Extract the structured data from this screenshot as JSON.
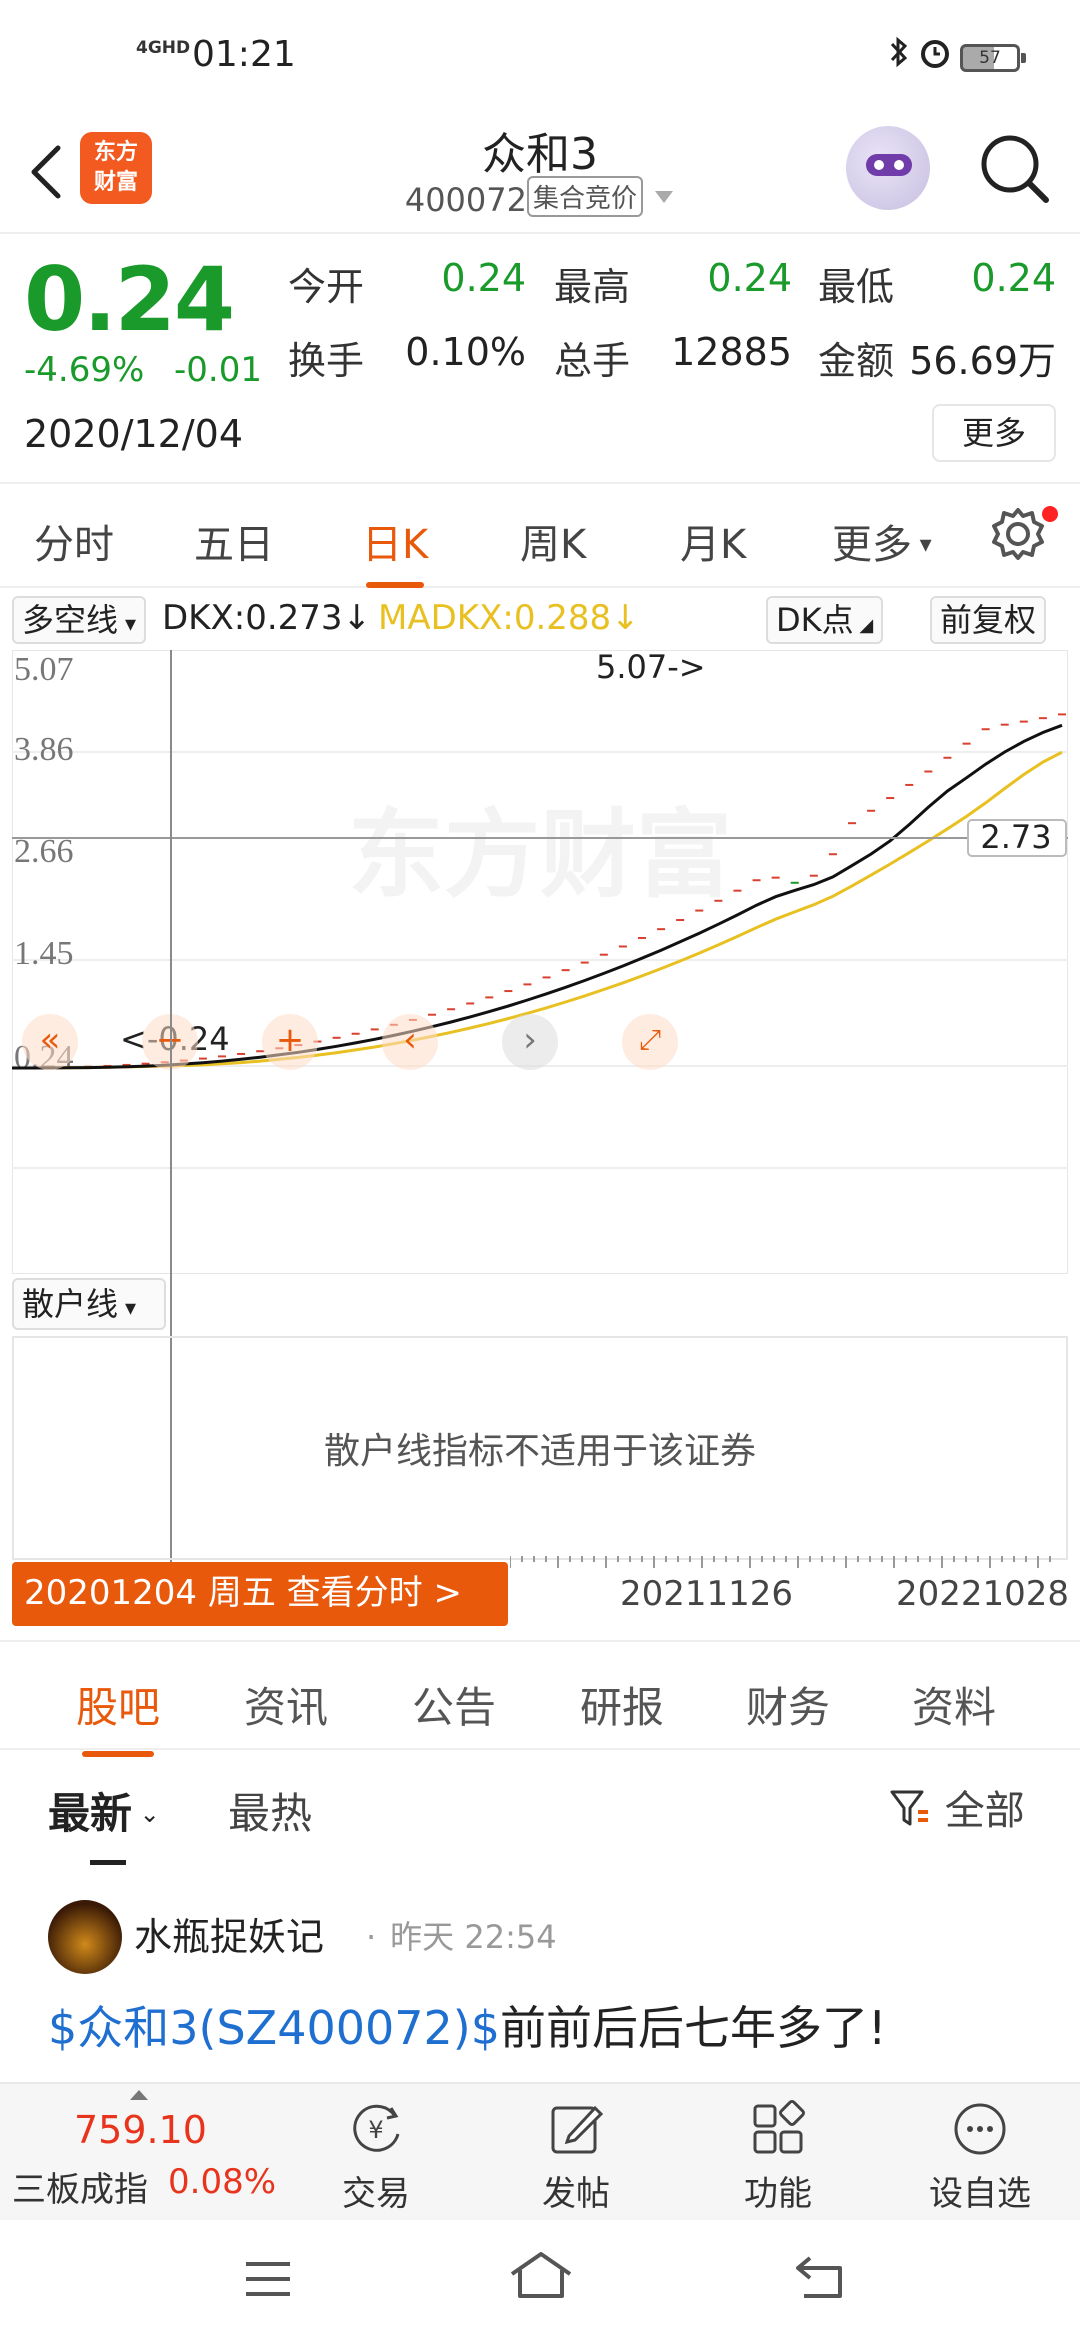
{
  "status_bar": {
    "network": "4GHD",
    "time": "01:21",
    "battery": "57",
    "icons": [
      "bluetooth-icon",
      "alarm-icon",
      "battery-icon"
    ]
  },
  "header": {
    "logo_line1": "东方",
    "logo_line2": "财富",
    "title": "众和3",
    "code": "400072",
    "auction_tag": "集合竞价"
  },
  "quote": {
    "price": "0.24",
    "change_pct": "-4.69%",
    "change": "-0.01",
    "date": "2020/12/04",
    "open_label": "今开",
    "open": "0.24",
    "high_label": "最高",
    "high": "0.24",
    "low_label": "最低",
    "low": "0.24",
    "turnover_label": "换手",
    "turnover": "0.10%",
    "volume_label": "总手",
    "volume": "12885",
    "amount_label": "金额",
    "amount": "56.69万",
    "more": "更多"
  },
  "chart_tabs": [
    "分时",
    "五日",
    "日K",
    "周K",
    "月K",
    "更多"
  ],
  "active_chart_tab": "日K",
  "indicator": {
    "selector": "多空线",
    "dkx": "DKX:0.273",
    "madkx": "MADKX:0.288",
    "dk_points": "DK点",
    "adjust": "前复权"
  },
  "chart": {
    "y_labels": [
      "5.07",
      "3.86",
      "2.66",
      "1.45",
      "0.24"
    ],
    "max_marker": "5.07->",
    "min_marker": "<-0.24",
    "crosshair_value": "2.73",
    "watermark": "东方财富",
    "colors": {
      "dkx": "#111111",
      "madkx": "#e8c021",
      "up": "#d94030",
      "down": "#1a9a2a"
    }
  },
  "sub_chart": {
    "selector": "散户线",
    "message": "散户线指标不适用于该证券"
  },
  "date_bar": {
    "label": "20201204 周五 查看分时 >",
    "axis_dates": [
      "20211126",
      "20221028"
    ]
  },
  "content_tabs": [
    "股吧",
    "资讯",
    "公告",
    "研报",
    "财务",
    "资料"
  ],
  "active_content_tab": "股吧",
  "sort": {
    "latest": "最新",
    "hot": "最热",
    "filter": "全部"
  },
  "post": {
    "author": "水瓶捉妖记",
    "time": "昨天 22:54",
    "link": "$众和3(SZ400072)$",
    "text": "前前后后七年多了!"
  },
  "bottom_bar": {
    "index_value": "759.10",
    "index_name": "三板成指",
    "index_pct": "0.08%",
    "items": [
      "交易",
      "发帖",
      "功能",
      "设自选"
    ]
  }
}
